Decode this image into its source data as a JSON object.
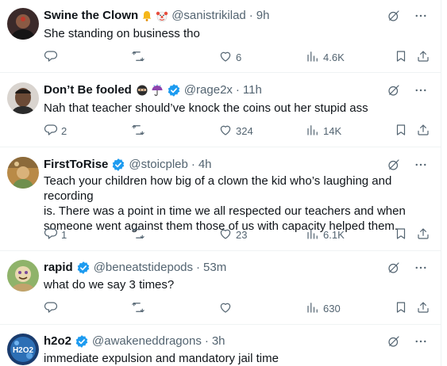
{
  "colors": {
    "text": "#0f1419",
    "secondary": "#536471",
    "verified": "#1d9bf0",
    "divider": "#eff3f4"
  },
  "tweets": [
    {
      "name": "Swine the Clown",
      "emojis": [
        "bell-emoji",
        "clown-emoji"
      ],
      "verified": false,
      "handle": "@sanistrikilad",
      "sep": "·",
      "time": "9h",
      "text": "She standing on business tho",
      "replies": "",
      "retweets": "",
      "likes": "6",
      "views": "4.6K"
    },
    {
      "name": "Don’t Be fooled",
      "emojis": [
        "ninja-emoji",
        "umbrella-emoji"
      ],
      "verified": true,
      "handle": "@rage2x",
      "sep": "·",
      "time": "11h",
      "text": "Nah that teacher should’ve knock the coins out her stupid ass",
      "replies": "2",
      "retweets": "",
      "likes": "324",
      "views": "14K"
    },
    {
      "name": "FirstToRise",
      "emojis": [],
      "verified": true,
      "handle": "@stoicpleb",
      "sep": "·",
      "time": "4h",
      "text_lines": [
        "Teach your children how big of a clown the kid who’s laughing and recording",
        "is. There was a point in time we all respected our teachers and when",
        "someone went against them those of us with capacity helped them."
      ],
      "replies": "1",
      "retweets": "",
      "likes": "23",
      "views": "6.1K"
    },
    {
      "name": "rapid",
      "emojis": [],
      "verified": true,
      "handle": "@beneatstidepods",
      "sep": "·",
      "time": "53m",
      "text": "what do we say 3 times?",
      "replies": "",
      "retweets": "",
      "likes": "",
      "views": "630"
    },
    {
      "name": "h2o2",
      "emojis": [],
      "verified": true,
      "handle": "@awakeneddragons",
      "sep": "·",
      "time": "3h",
      "text": "immediate expulsion and mandatory jail time",
      "avatar_text": "H2O2"
    }
  ]
}
